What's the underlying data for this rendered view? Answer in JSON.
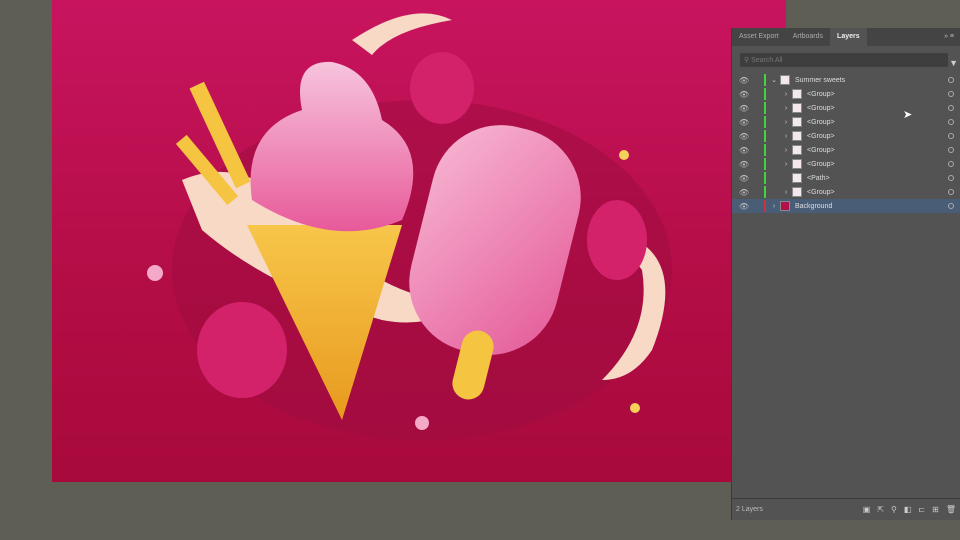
{
  "panel": {
    "tabs": [
      "Asset Export",
      "Artboards",
      "Layers"
    ],
    "active_tab": "Layers",
    "search_placeholder": "Search All",
    "layers": [
      {
        "name": "Summer sweets",
        "expanded": true,
        "level": 0
      },
      {
        "name": "<Group>",
        "level": 1
      },
      {
        "name": "<Group>",
        "level": 1
      },
      {
        "name": "<Group>",
        "level": 1
      },
      {
        "name": "<Group>",
        "level": 1
      },
      {
        "name": "<Group>",
        "level": 1
      },
      {
        "name": "<Group>",
        "level": 1
      },
      {
        "name": "<Path>",
        "level": 1
      },
      {
        "name": "<Group>",
        "level": 1
      },
      {
        "name": "Background",
        "level": 0,
        "selected": true
      }
    ],
    "footer": {
      "count": "2 Layers"
    }
  },
  "colors": {
    "accent_green": "#3ed43e",
    "bg_layer_red": "#d0303a"
  }
}
